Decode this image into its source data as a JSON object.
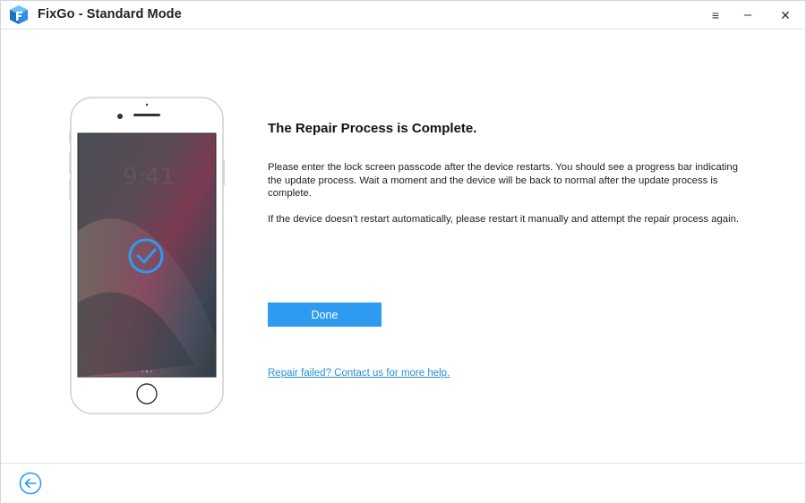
{
  "titlebar": {
    "title": "FixGo - Standard Mode",
    "menu_icon": "≡",
    "minimize_icon": "–",
    "close_icon": "✕"
  },
  "main": {
    "heading": "The Repair Process is Complete.",
    "paragraph1": "Please enter the lock screen passcode after the device restarts. You should see a progress bar indicating the update process. Wait a moment and the device will be back to normal after the update process is complete.",
    "paragraph2": "If the device doesn’t restart automatically, please restart it manually and attempt the repair process again.",
    "done_label": "Done",
    "help_link": "Repair failed? Contact us for more help."
  },
  "colors": {
    "accent": "#2e9af0",
    "link": "#2a8fd6",
    "check": "#2e9af0"
  },
  "icons": {
    "app_logo": "fixgo-logo-icon",
    "menu": "menu-icon",
    "minimize": "minimize-icon",
    "close": "close-icon",
    "success": "checkmark-circle-icon",
    "back": "back-arrow-icon"
  }
}
